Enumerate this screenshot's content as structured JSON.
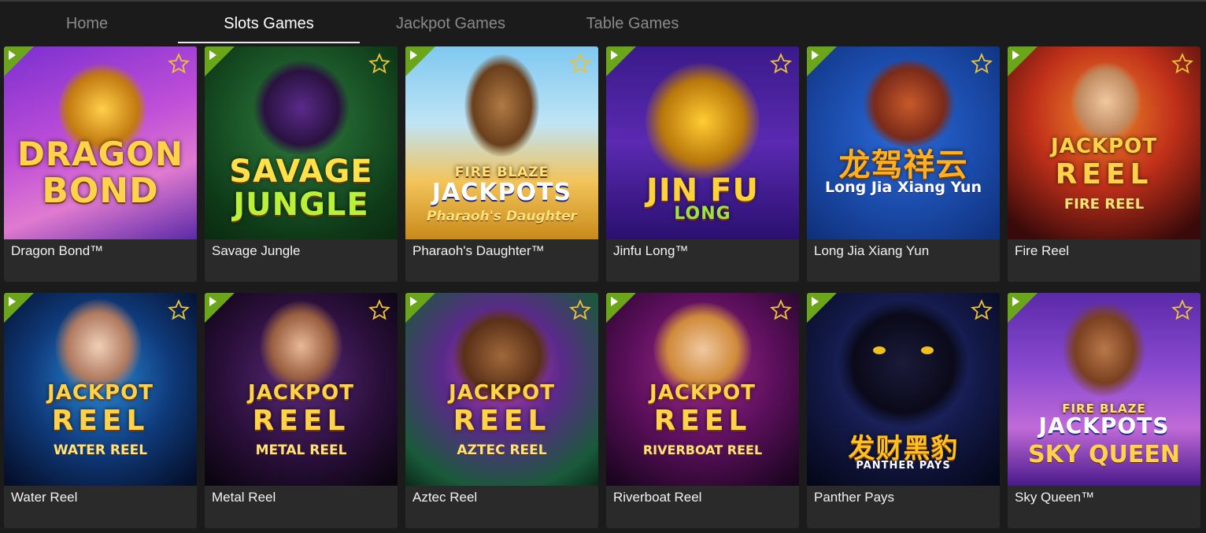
{
  "tabs": [
    {
      "label": "Home"
    },
    {
      "label": "Slots Games"
    },
    {
      "label": "Jackpot Games"
    },
    {
      "label": "Table Games"
    }
  ],
  "games": [
    {
      "name": "Dragon Bond™",
      "art_title": "DRAGON",
      "art_title2": "BOND",
      "art_sub": ""
    },
    {
      "name": "Savage Jungle",
      "art_title": "SAVAGE",
      "art_title2": "JUNGLE",
      "art_sub": ""
    },
    {
      "name": "Pharaoh's Daughter™",
      "art_title": "FIRE BLAZE",
      "art_title2": "JACKPOTS",
      "art_sub": "Pharaoh's Daughter"
    },
    {
      "name": "Jinfu Long™",
      "art_title": "JIN FU",
      "art_title2": "LONG",
      "art_sub": ""
    },
    {
      "name": "Long Jia Xiang Yun",
      "art_title": "龙驾祥云",
      "art_title2": "Long Jia Xiang Yun",
      "art_sub": ""
    },
    {
      "name": "Fire Reel",
      "art_title": "JACKPOT",
      "art_title2": "REEL",
      "art_sub": "FIRE REEL"
    },
    {
      "name": "Water Reel",
      "art_title": "JACKPOT",
      "art_title2": "REEL",
      "art_sub": "WATER REEL"
    },
    {
      "name": "Metal Reel",
      "art_title": "JACKPOT",
      "art_title2": "REEL",
      "art_sub": "METAL REEL"
    },
    {
      "name": "Aztec Reel",
      "art_title": "JACKPOT",
      "art_title2": "REEL",
      "art_sub": "AZTEC REEL"
    },
    {
      "name": "Riverboat Reel",
      "art_title": "JACKPOT",
      "art_title2": "REEL",
      "art_sub": "RIVERBOAT REEL"
    },
    {
      "name": "Panther Pays",
      "art_title": "发财黑豹",
      "art_title2": "PANTHER PAYS",
      "art_sub": ""
    },
    {
      "name": "Sky Queen™",
      "art_title": "FIRE BLAZE",
      "art_title2": "JACKPOTS",
      "art_sub": "SKY QUEEN"
    }
  ],
  "colors": {
    "accent_green": "#6aa51a",
    "star_gold": "#e8c23a",
    "active_tab": "#ffffff",
    "inactive_tab": "#8a8a8a"
  },
  "icons": {
    "play": "play-icon",
    "favorite": "star-icon"
  }
}
